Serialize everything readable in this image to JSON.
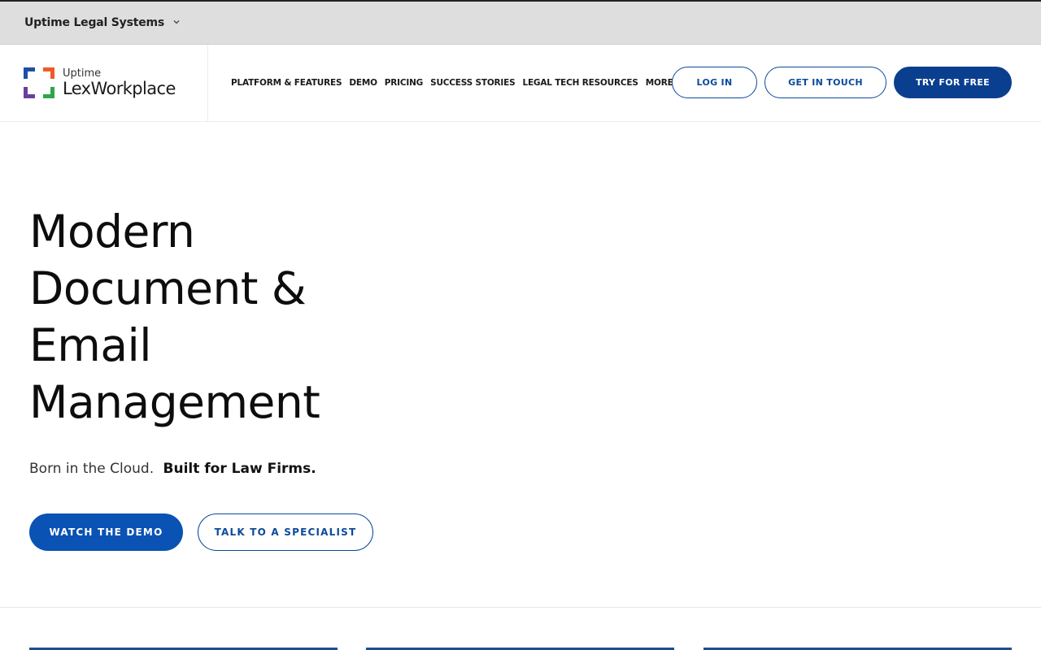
{
  "topbar": {
    "company_name": "Uptime Legal Systems",
    "dropdown_icon": "chevron-down-icon"
  },
  "logo": {
    "small_text": "Uptime",
    "brand_text": "LexWorkplace",
    "colors": [
      "#1e4fa3",
      "#f05a28",
      "#6b3fa0",
      "#2ba84a"
    ]
  },
  "nav": {
    "items": [
      {
        "label": "PLATFORM & FEATURES"
      },
      {
        "label": "DEMO"
      },
      {
        "label": "PRICING"
      },
      {
        "label": "SUCCESS STORIES"
      },
      {
        "label": "LEGAL TECH RESOURCES"
      },
      {
        "label": "MORE"
      }
    ]
  },
  "header_actions": {
    "login": "LOG IN",
    "get_in_touch": "GET IN TOUCH",
    "try_free": "TRY FOR FREE"
  },
  "hero": {
    "title_lines": [
      "Modern",
      "Document &",
      "Email",
      "Management"
    ],
    "subtitle_light": "Born in the Cloud.",
    "subtitle_bold": "Built for Law Firms.",
    "primary_cta": "WATCH THE DEMO",
    "secondary_cta": "TALK TO A SPECIALIST"
  },
  "colors": {
    "brand_blue": "#0a3f8f",
    "cta_blue": "#0a52b4",
    "topbar_bg": "#dedede"
  }
}
